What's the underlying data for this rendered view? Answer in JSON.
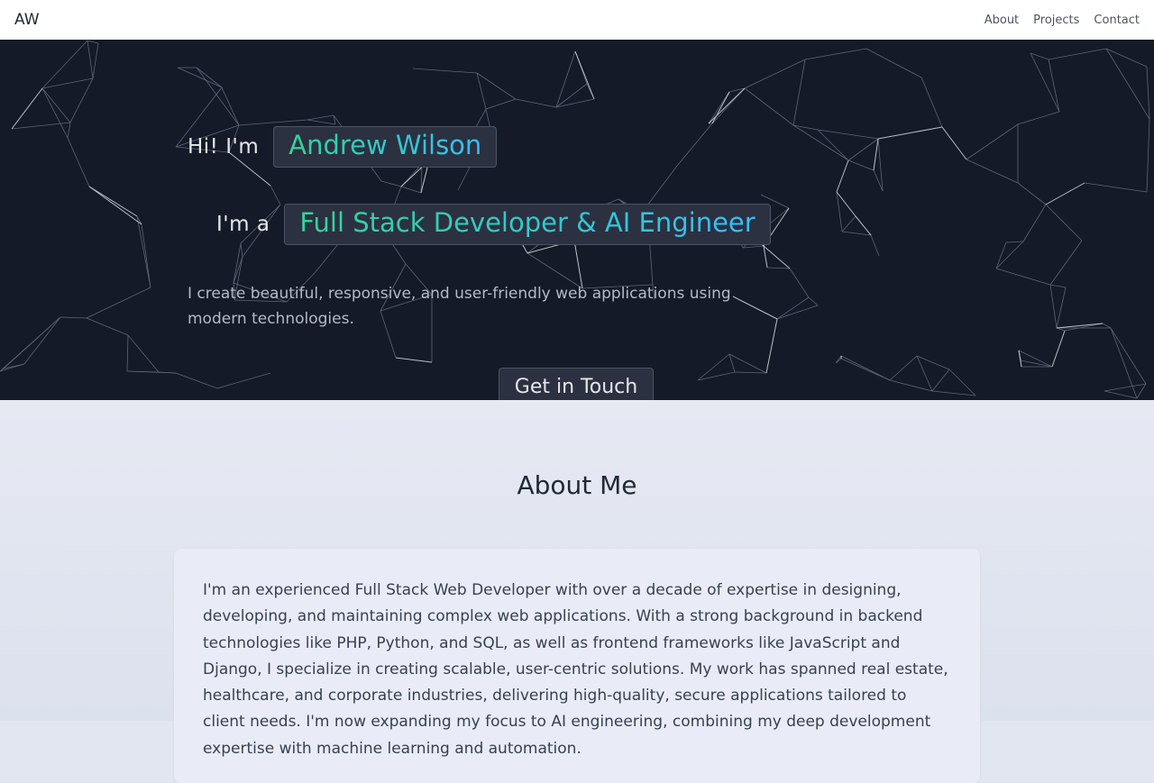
{
  "nav": {
    "logo": "AW",
    "links": [
      "About",
      "Projects",
      "Contact"
    ]
  },
  "hero": {
    "greeting_prefix": "Hi! I'm",
    "name": "Andrew Wilson",
    "role_prefix": "I'm a",
    "role": "Full Stack Developer & AI Engineer",
    "intro": "I create beautiful, responsive, and user-friendly web applications using modern technologies.",
    "cta_label": "Get in Touch"
  },
  "about": {
    "title": "About Me",
    "body": "I'm an experienced Full Stack Web Developer with over a decade of expertise in designing, developing, and maintaining complex web applications. With a strong background in backend technologies like PHP, Python, and SQL, as well as frontend frameworks like JavaScript and Django, I specialize in creating scalable, user-centric solutions. My work has spanned real estate, healthcare, and corporate industries, delivering high-quality, secure applications tailored to client needs. I'm now expanding my focus to AI engineering, combining my deep development expertise with machine learning and automation."
  },
  "colors": {
    "hero_bg": "#141a28",
    "gradient_start": "#34d399",
    "gradient_end": "#38bdf8",
    "navbar_bg": "#ffffff",
    "about_bg": "#e2e6f0"
  }
}
